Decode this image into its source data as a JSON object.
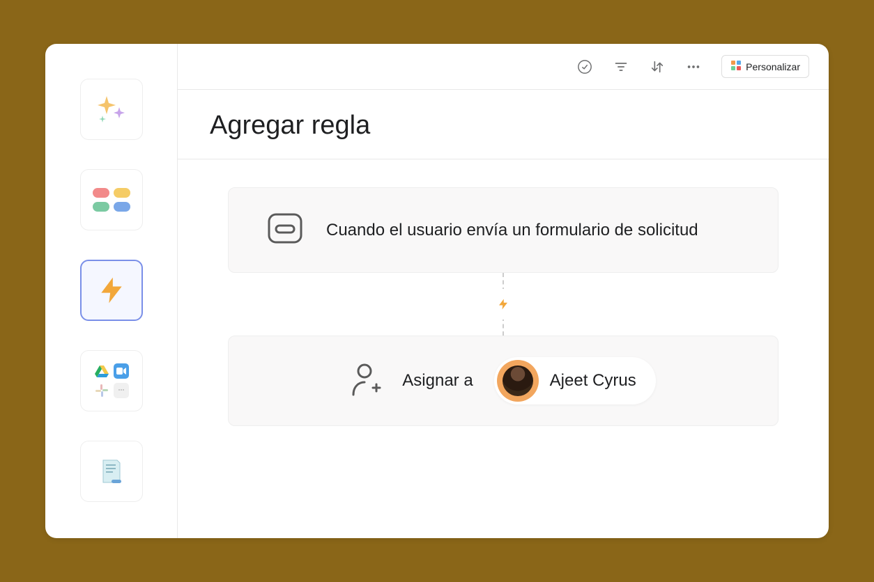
{
  "toolbar": {
    "customize_label": "Personalizar"
  },
  "header": {
    "title": "Agregar regla"
  },
  "rule": {
    "trigger_text": "Cuando el usuario envía un formulario de solicitud",
    "action_label": "Asignar a",
    "assignee_name": "Ajeet Cyrus"
  },
  "sidebar": {
    "items": [
      {
        "name": "ai-sparkles",
        "active": false
      },
      {
        "name": "widgets",
        "active": false
      },
      {
        "name": "rules",
        "active": true
      },
      {
        "name": "apps",
        "active": false
      },
      {
        "name": "template",
        "active": false
      }
    ]
  },
  "colors": {
    "accent": "#f2a73a",
    "bg": "#8a6618"
  }
}
